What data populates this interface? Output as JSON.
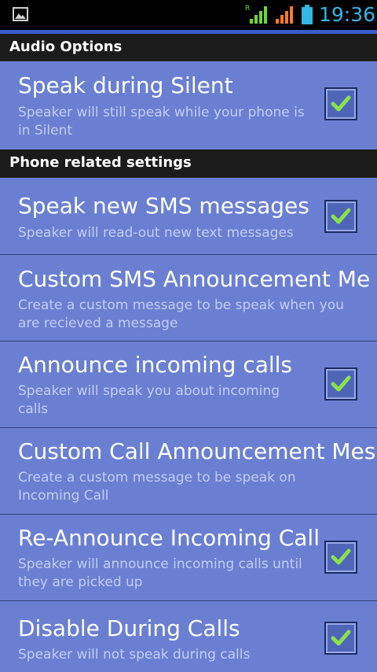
{
  "status_bar": {
    "time": "19:36",
    "roaming_indicator": "R",
    "icons": [
      "image-notification-icon",
      "signal-roaming-icon",
      "signal-icon",
      "battery-icon"
    ]
  },
  "colors": {
    "background": "#6b7fd2",
    "section_header": "#1b1b1b",
    "title_text": "#ffffff",
    "summary_text": "#c2cdf2",
    "check": "#8be04e",
    "clock": "#33b5e5"
  },
  "sections": [
    {
      "header": "Audio Options",
      "items": [
        {
          "title": "Speak during Silent",
          "summary": "Speaker will still speak while your phone is in Silent",
          "checked": true
        }
      ]
    },
    {
      "header": "Phone related settings",
      "items": [
        {
          "title": "Speak new SMS messages",
          "summary": "Speaker will read-out new text messages",
          "checked": true
        },
        {
          "title": "Custom SMS Announcement Me",
          "summary": "Create a custom message to be speak when you are recieved a message"
        },
        {
          "title": "Announce incoming calls",
          "summary": "Speaker will speak you about incoming calls",
          "checked": true
        },
        {
          "title": "Custom Call Announcement Mes",
          "summary": "Create a custom message to be speak on Incoming Call"
        },
        {
          "title": "Re-Announce Incoming Call",
          "summary": "Speaker will announce incoming calls until they are picked up",
          "checked": true
        },
        {
          "title": "Disable During Calls",
          "summary": "Speaker will not speak during calls",
          "checked": true
        }
      ]
    }
  ]
}
